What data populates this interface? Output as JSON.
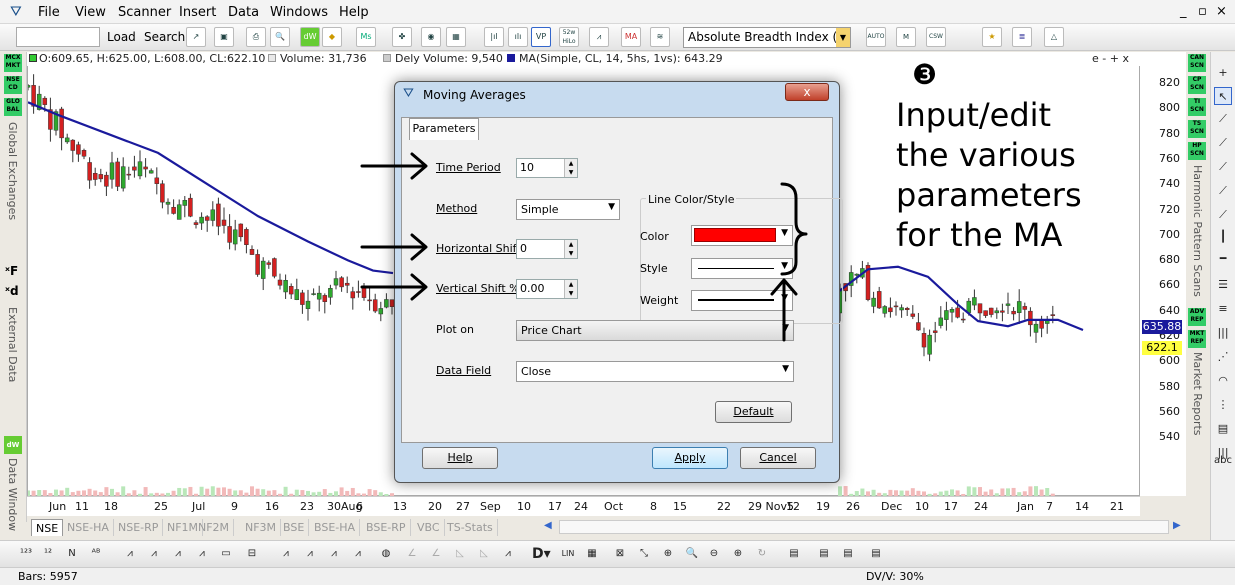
{
  "menu": {
    "items": [
      "File",
      "View",
      "Scanner",
      "Insert",
      "Data",
      "Windows",
      "Help"
    ],
    "window_controls": [
      "_",
      "▫",
      "×"
    ]
  },
  "toolbar": {
    "load_label": "Load",
    "search_label": "Search",
    "indicator_value": "Absolute Breadth Index (ABI",
    "btn_52w": "52w\nHiLo",
    "btn_ma": "MA"
  },
  "infobar": {
    "ohlc": "O:609.65, H:625.00, L:608.00, CL:622.10",
    "volume": "Volume: 31,736",
    "delivery": "Dely Volume: 9,540",
    "ma": "MA(Simple, CL, 14, 5hs, 1vs): 643.29",
    "corner": "e - + x"
  },
  "yaxis": {
    "ticks": [
      "820",
      "800",
      "780",
      "760",
      "740",
      "720",
      "700",
      "680",
      "660",
      "640",
      "620",
      "600",
      "580",
      "560",
      "540"
    ],
    "last_price": "622.1",
    "ma_value": "635.88"
  },
  "xaxis": {
    "ticks": [
      "Jun",
      "11",
      "18",
      "25",
      "Jul",
      "9",
      "16",
      "23",
      "30Aug",
      "6",
      "13",
      "20",
      "27",
      "Sep",
      "10",
      "17",
      "24",
      "Oct",
      "8",
      "15",
      "22",
      "29 Nov5",
      "12",
      "19",
      "26",
      "Dec",
      "10",
      "17",
      "24",
      "Jan",
      "7",
      "14",
      "21"
    ]
  },
  "left_strip": {
    "badges": [
      "MCX\nMKT",
      "NSE\nCD",
      "GLO\nBAL"
    ],
    "global_label": "Global Exchanges",
    "external_label": "External Data",
    "data_window_label": "Data Window"
  },
  "right_strip": {
    "badges": [
      "CAN\nSCN",
      "CP\nSCN",
      "TI\nSCN",
      "TS\nSCN",
      "HP\nSCN"
    ],
    "harmonic_label": "Harmonic Pattern Scans",
    "market_badges": [
      "ADV\nREP",
      "MKT\nREP"
    ],
    "market_label": "Market Reports",
    "abc": "abc"
  },
  "tabs": [
    "NSE",
    "NSE-HA",
    "NSE-RP",
    "NF1M",
    "NF2M",
    "NF3M",
    "BSE",
    "BSE-HA",
    "BSE-RP",
    "VBC",
    "TS-Stats"
  ],
  "status": {
    "bars": "Bars: 5957",
    "dvv": "DV/V: 30%"
  },
  "dialog": {
    "title": "Moving Averages",
    "tab": "Parameters",
    "time_period_label": "Time Period",
    "time_period_value": "10",
    "method_label": "Method",
    "method_value": "Simple",
    "hshift_label": "Horizontal Shift",
    "hshift_value": "0",
    "vshift_label": "Vertical Shift %",
    "vshift_value": "0.00",
    "plot_on_label": "Plot on",
    "plot_on_value": "Price Chart",
    "data_field_label": "Data Field",
    "data_field_value": "Close",
    "group_title": "Line Color/Style",
    "color_label": "Color",
    "style_label": "Style",
    "weight_label": "Weight",
    "default_btn": "Default",
    "help_btn": "Help",
    "apply_btn": "Apply",
    "cancel_btn": "Cancel",
    "close_glyph": "x"
  },
  "annotation": {
    "number": "❸",
    "lines": [
      "Input/edit",
      "the various",
      "parameters",
      "for the MA"
    ]
  },
  "colors": {
    "ma_line": "#1a1a9c",
    "candle_up": "#2ea82e",
    "candle_down": "#d42020",
    "ma_color_swatch": "#ff0000"
  }
}
